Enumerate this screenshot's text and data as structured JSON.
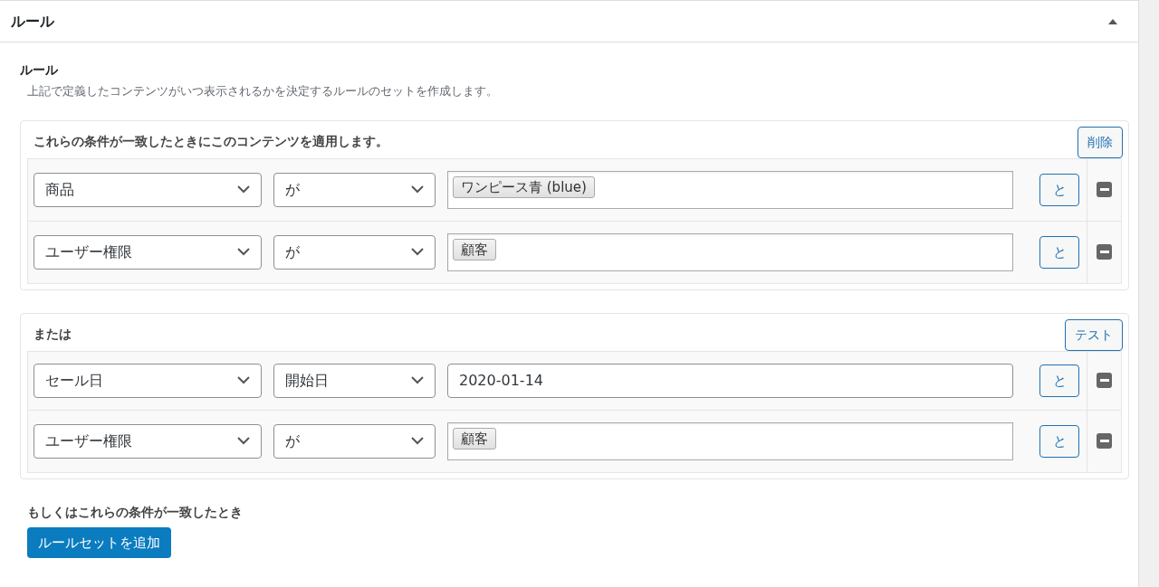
{
  "panel": {
    "title": "ルール",
    "expanded": true
  },
  "section": {
    "title": "ルール",
    "description": "上記で定義したコンテンツがいつ表示されるかを決定するルールのセットを作成します。"
  },
  "rule_sets": [
    {
      "title": "これらの条件が一致したときにこのコンテンツを適用します。",
      "button": "削除",
      "rows": [
        {
          "field": "商品",
          "operator": "が",
          "value": {
            "kind": "tags",
            "tags": [
              "ワンピース青 (blue)"
            ]
          },
          "and_button": "と"
        },
        {
          "field": "ユーザー権限",
          "operator": "が",
          "value": {
            "kind": "tags",
            "tags": [
              "顧客"
            ]
          },
          "and_button": "と"
        }
      ]
    },
    {
      "title": "または",
      "button": "テスト",
      "rows": [
        {
          "field": "セール日",
          "operator": "開始日",
          "value": {
            "kind": "text",
            "text": "2020-01-14"
          },
          "and_button": "と"
        },
        {
          "field": "ユーザー権限",
          "operator": "が",
          "value": {
            "kind": "tags",
            "tags": [
              "顧客"
            ]
          },
          "and_button": "と"
        }
      ]
    }
  ],
  "footer": {
    "label": "もしくはこれらの条件が一致したとき",
    "button": "ルールセットを追加"
  }
}
